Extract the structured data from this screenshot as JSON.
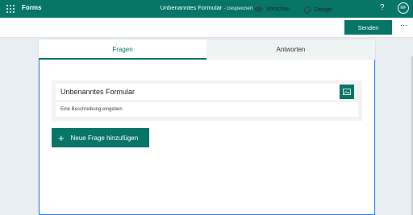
{
  "appbar": {
    "app_name": "Forms",
    "form_title": "Unbenanntes Formular",
    "status": "- Gespeichert",
    "help": "?",
    "avatar_initials": "MF"
  },
  "toolbar": {
    "preview_label": "Vorschau",
    "design_label": "Design",
    "send_label": "Senden",
    "more": "···"
  },
  "tabs": [
    {
      "label": "Fragen",
      "active": true
    },
    {
      "label": "Antworten",
      "active": false
    }
  ],
  "form": {
    "title": "Unbenanntes Formular",
    "description_placeholder": "Eine Beschreibung eingeben"
  },
  "add_question_label": "Neue Frage hinzufügen",
  "colors": {
    "accent": "#077568",
    "background": "#e9eef2"
  }
}
